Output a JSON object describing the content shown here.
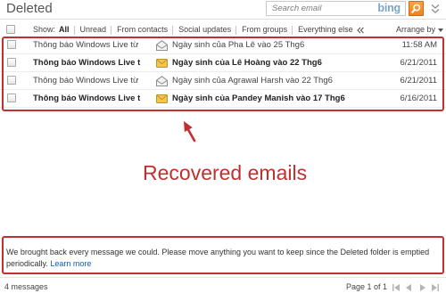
{
  "header": {
    "title": "Deleted",
    "search": {
      "placeholder": "Search email",
      "logo_text": "bing"
    }
  },
  "filter_bar": {
    "show_label": "Show:",
    "filters": [
      {
        "label": "All",
        "active": true
      },
      {
        "label": "Unread",
        "active": false
      },
      {
        "label": "From contacts",
        "active": false
      },
      {
        "label": "Social updates",
        "active": false
      },
      {
        "label": "From groups",
        "active": false
      },
      {
        "label": "Everything else",
        "active": false
      }
    ],
    "arrange_label": "Arrange by"
  },
  "messages": [
    {
      "sender": "Thông báo Windows Live từ",
      "subject": "Ngày sinh của Pha Lê vào 25 Thg6",
      "date": "11:58 AM",
      "unread": false
    },
    {
      "sender": "Thông báo Windows Live t",
      "subject": "Ngày sinh của Lê Hoàng vào 22 Thg6",
      "date": "6/21/2011",
      "unread": true
    },
    {
      "sender": "Thông báo Windows Live từ",
      "subject": "Ngày sinh của Agrawal Harsh vào 22 Thg6",
      "date": "6/21/2011",
      "unread": false
    },
    {
      "sender": "Thông báo Windows Live t",
      "subject": "Ngày sinh của Pandey Manish vào 17 Thg6",
      "date": "6/16/2011",
      "unread": true
    }
  ],
  "annotation": {
    "label": "Recovered emails"
  },
  "notice": {
    "text": "We brought back every message we could. Please move anything you want to keep since the Deleted folder is emptied periodically.",
    "link": "Learn more"
  },
  "footer": {
    "message_count": "4 messages",
    "page_info": "Page 1 of 1"
  },
  "icons": {
    "search_button": "search-icon",
    "header_toggle": "double-chevron-down-icon",
    "select_all": "checkbox",
    "filter_collapse": "double-chevron-left-icon",
    "arrange_dropdown": "caret-down-icon",
    "read_message": "read-envelope-icon",
    "unread_message": "unread-envelope-icon",
    "annotation": "red-arrow-icon",
    "pagination": [
      "first-page-icon",
      "previous-page-icon",
      "next-page-icon",
      "last-page-icon"
    ]
  },
  "colors": {
    "annotation_red": "#c0302f",
    "link_blue": "#0b5fb3",
    "search_button_orange": "#f0821e",
    "unread_envelope_yellow": "#f5c544"
  }
}
